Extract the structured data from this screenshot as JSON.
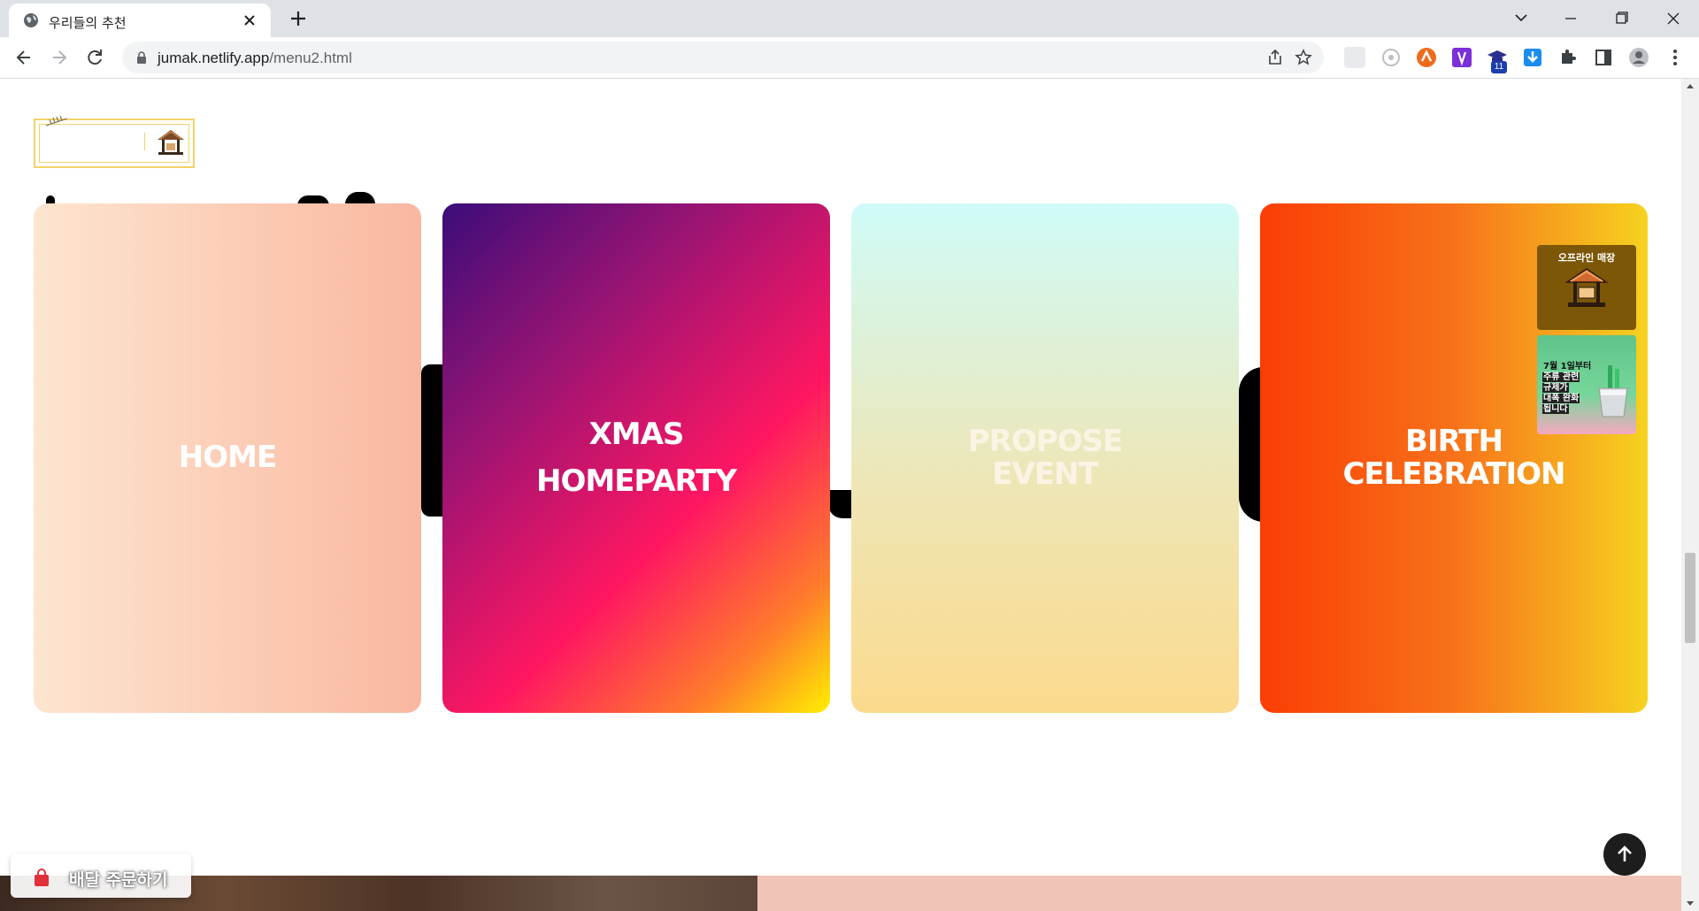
{
  "browser": {
    "tab_title": "우리들의 추천",
    "url_host": "jumak.netlify.app",
    "url_path": "/menu2.html",
    "extension_badge": "11"
  },
  "page": {
    "cards": [
      {
        "label": "HOME"
      },
      {
        "label": "XMAS\nHOMEPARTY"
      },
      {
        "label": "PROPOSE\nEVENT"
      },
      {
        "label": "BIRTH\nCELEBRATION"
      }
    ],
    "ads": {
      "offline_heading": "오프라인 매장",
      "liquor_lines": [
        "7월 1일부터",
        "주류 관련",
        "규제가",
        "대폭 완화",
        "됩니다"
      ]
    },
    "order_button_label": "배달 주문하기"
  },
  "colors": {
    "accent_yellow": "#f3d36a",
    "scroll_top_bg": "#1d1d1d"
  }
}
